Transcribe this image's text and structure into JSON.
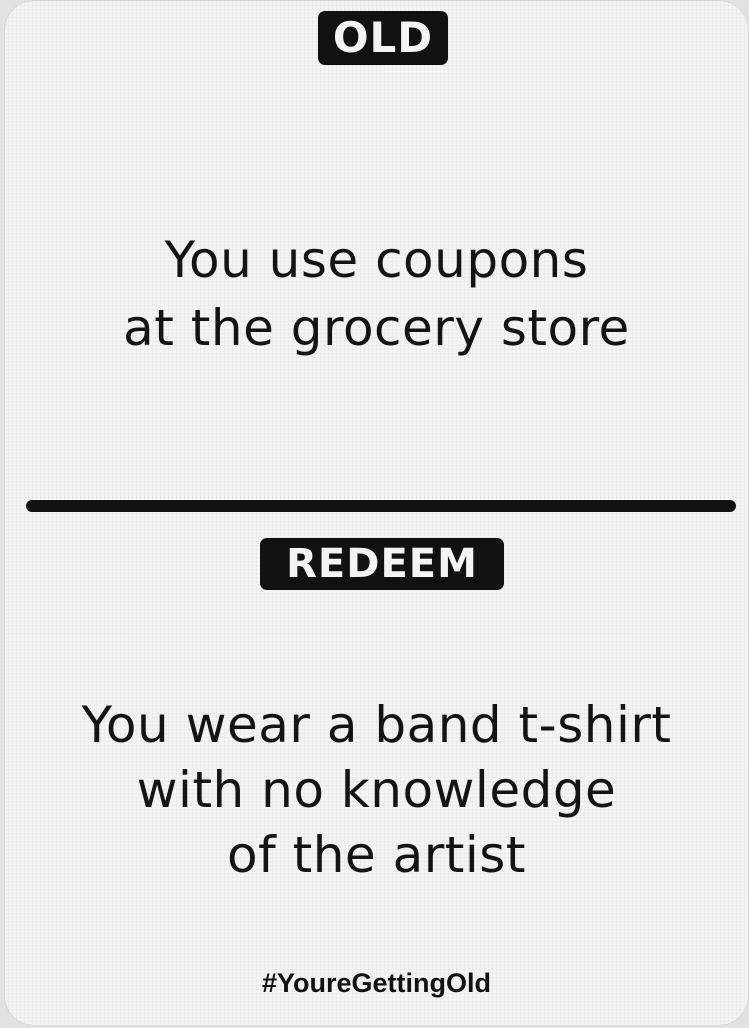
{
  "card": {
    "old_label": "OLD",
    "old_text": {
      "line1": "You use coupons",
      "line2": "at the grocery store"
    },
    "redeem_label": "REDEEM",
    "redeem_text": {
      "line1": "You wear a band t-shirt",
      "line2": "with no knowledge",
      "line3": "of the artist"
    },
    "hashtag": "#YoureGettingOld"
  },
  "colors": {
    "card_background": "#f4f4f4",
    "ink": "#111111"
  }
}
